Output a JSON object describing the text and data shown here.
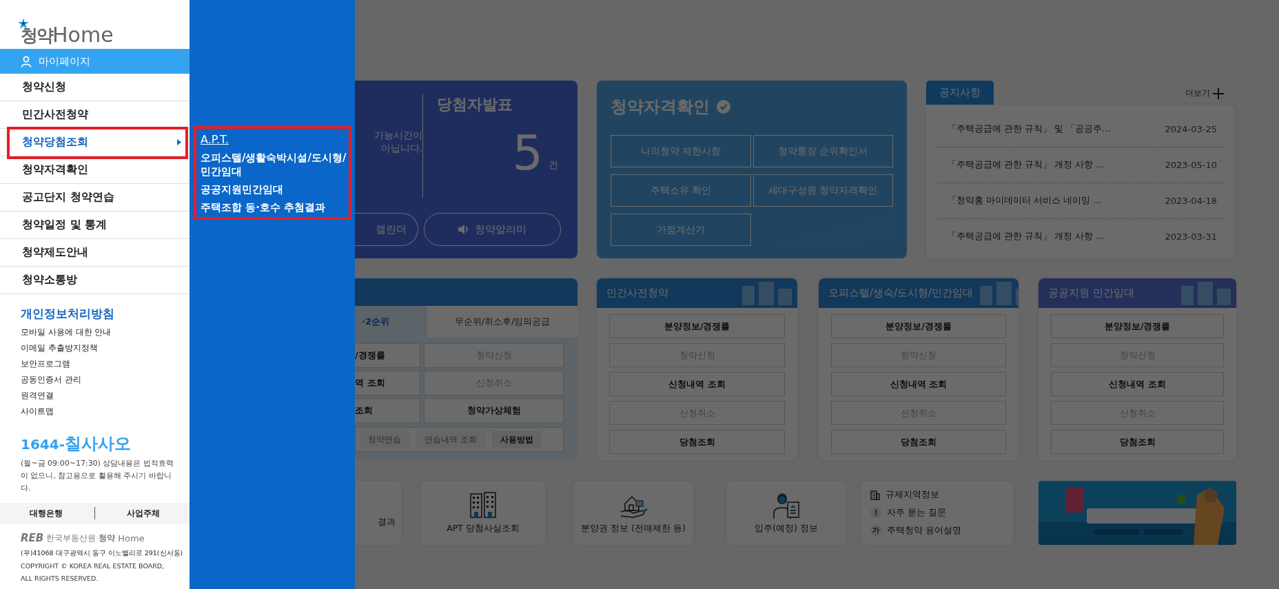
{
  "sidebar": {
    "logo_mark": "청약",
    "logo_word": "Home",
    "mypage": "마이페이지",
    "menu": [
      {
        "label": "청약신청",
        "selected": false,
        "highlighted": false
      },
      {
        "label": "민간사전청약",
        "selected": false,
        "highlighted": false
      },
      {
        "label": "청약당첨조회",
        "selected": true,
        "highlighted": true
      },
      {
        "label": "청약자격확인",
        "selected": false,
        "highlighted": false
      },
      {
        "label": "공고단지 청약연습",
        "selected": false,
        "highlighted": false
      },
      {
        "label": "청약일정 및 통계",
        "selected": false,
        "highlighted": false
      },
      {
        "label": "청약제도안내",
        "selected": false,
        "highlighted": false
      },
      {
        "label": "청약소통방",
        "selected": false,
        "highlighted": false
      }
    ],
    "policy": "개인정보처리방침",
    "links": [
      "모바일 사용에 대한 안내",
      "이메일 추출방지정책",
      "보안프로그램",
      "공동인증서 관리",
      "원격연결",
      "사이트맵"
    ],
    "phone_prefix": "1644-",
    "phone_word": "칠사사오",
    "phone_note": "(월~금 09:00~17:30) 상담내용은 법적효력이 없으니, 참고용으로 활용해 주시기 바랍니다.",
    "footer_tabs": [
      "대행은행",
      "사업주체"
    ],
    "footer_logo": {
      "mark": "REB",
      "org": "한국부동산원",
      "brand_mark": "청약",
      "brand_word": "Home"
    },
    "address": "(우)41068 대구광역시 동구 이노밸리로 291(신서동)",
    "copyright": "COPYRIGHT © KOREA REAL ESTATE BOARD, ALL RIGHTS RESERVED."
  },
  "submenu": {
    "highlighted": true,
    "items": [
      {
        "label": "A.P.T.",
        "hovered": true
      },
      {
        "label": "오피스텔/생활숙박시설/도시형/민간임대",
        "hovered": false
      },
      {
        "label": "공공지원민간임대",
        "hovered": false
      },
      {
        "label": "주택조합 동·호수 추첨결과",
        "hovered": false
      }
    ]
  },
  "announce_card": {
    "notice_lines": [
      "가능시간이",
      "아닙니다."
    ],
    "title": "당첨자발표",
    "count": "5",
    "unit": "건",
    "buttons": [
      {
        "label": "캘린더",
        "kind": "plain"
      },
      {
        "label": "청약알리미",
        "kind": "speaker"
      }
    ]
  },
  "eligibility_card": {
    "title": "청약자격확인",
    "buttons": [
      "나의청약 제한사항",
      "청약통장 순위확인서",
      "주택소유 확인",
      "세대구성원 청약자격확인",
      "가점계산기"
    ]
  },
  "notices": {
    "tab": "공지사항",
    "more": "더보기",
    "items": [
      {
        "title": "「주택공급에 관한 규칙」 및 「공공주…",
        "date": "2024-03-25"
      },
      {
        "title": "「주택공급에 관한 규칙」 개정 사항 …",
        "date": "2023-05-10"
      },
      {
        "title": "「청약홈 마이데이터 서비스 네이밍 …",
        "date": "2023-04-18"
      },
      {
        "title": "「주택공급에 관한 규칙」 개정 사항 …",
        "date": "2023-03-31"
      }
    ]
  },
  "apt_card": {
    "tabs": [
      {
        "label": "·2순위",
        "selected": true
      },
      {
        "label": "무순위/취소후/임의공급",
        "selected": false
      }
    ],
    "buttons": [
      {
        "label": "/경쟁률",
        "enabled": true
      },
      {
        "label": "청약신청",
        "enabled": false
      },
      {
        "label": "역 조회",
        "enabled": true
      },
      {
        "label": "신청취소",
        "enabled": false
      },
      {
        "label": "조회",
        "enabled": true
      },
      {
        "label": "청약가상체험",
        "enabled": true
      }
    ],
    "practice_buttons": [
      {
        "label": "청약연습",
        "enabled": false
      },
      {
        "label": "연습내역 조회",
        "enabled": false
      },
      {
        "label": "사용방법",
        "enabled": true
      }
    ]
  },
  "category_cards": [
    {
      "title": "민간사전청약",
      "buttons": [
        {
          "label": "분양정보/경쟁률",
          "enabled": true
        },
        {
          "label": "청약신청",
          "enabled": false
        },
        {
          "label": "신청내역 조회",
          "enabled": true
        },
        {
          "label": "신청취소",
          "enabled": false
        },
        {
          "label": "당첨조회",
          "enabled": true
        }
      ]
    },
    {
      "title": "오피스텔/생숙/도시형/민간임대",
      "buttons": [
        {
          "label": "분양정보/경쟁률",
          "enabled": true
        },
        {
          "label": "청약신청",
          "enabled": false
        },
        {
          "label": "신청내역 조회",
          "enabled": true
        },
        {
          "label": "신청취소",
          "enabled": false
        },
        {
          "label": "당첨조회",
          "enabled": true
        }
      ]
    },
    {
      "title": "공공지원 민간임대",
      "buttons": [
        {
          "label": "분양정보/경쟁률",
          "enabled": true
        },
        {
          "label": "청약신청",
          "enabled": false
        },
        {
          "label": "신청내역 조회",
          "enabled": true
        },
        {
          "label": "신청취소",
          "enabled": false
        },
        {
          "label": "당첨조회",
          "enabled": true
        }
      ]
    }
  ],
  "quick_links": [
    {
      "label": "결과",
      "kind": "none"
    },
    {
      "label": "APT 당첨사실조회",
      "kind": "buildings"
    },
    {
      "label": "분양권 정보 (전매제한 등)",
      "kind": "house-hand"
    },
    {
      "label": "입주(예정) 정보",
      "kind": "person-document"
    }
  ],
  "info_links": [
    {
      "label": "규제지역정보",
      "kind": "icon"
    },
    {
      "label": "자주 묻는 질문",
      "kind": "badge",
      "badge": "!"
    },
    {
      "label": "주택청약 용어설명",
      "kind": "badge",
      "badge": "가"
    }
  ]
}
